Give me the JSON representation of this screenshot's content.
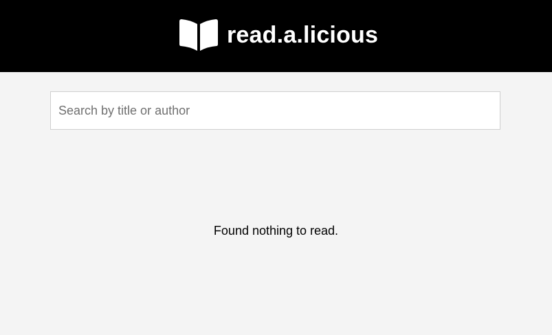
{
  "header": {
    "logo_icon": "open-book-icon",
    "title": "read.a.licious",
    "background_color": "#000000",
    "text_color": "#ffffff"
  },
  "search": {
    "value": "",
    "placeholder": "Search by title or author"
  },
  "results": {
    "empty_message": "Found nothing to read."
  },
  "page": {
    "background_color": "#f4f4f4"
  }
}
